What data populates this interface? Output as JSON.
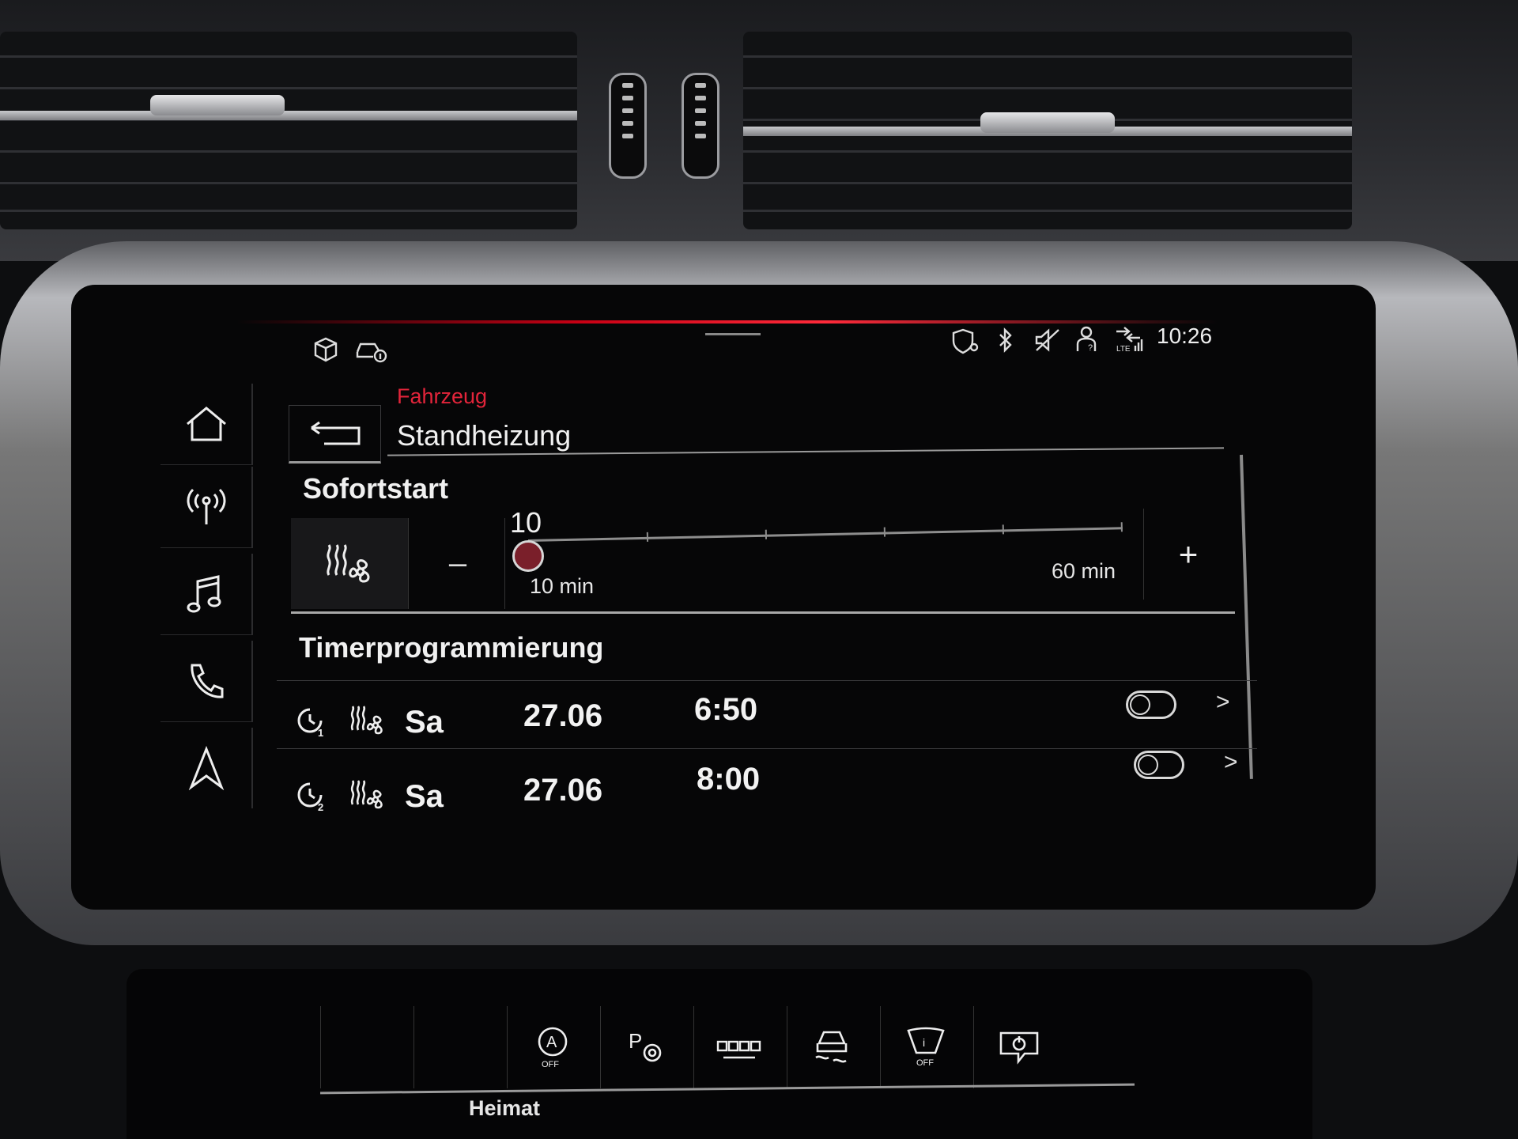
{
  "status_bar": {
    "clock": "10:26",
    "icons": [
      "package-icon",
      "car-info-icon",
      "location-shield-icon",
      "bluetooth-icon",
      "mute-icon",
      "driver-profile-icon",
      "lte-signal-icon"
    ]
  },
  "sidebar": {
    "items": [
      {
        "name": "home",
        "icon": "home-icon"
      },
      {
        "name": "radio",
        "icon": "antenna-icon"
      },
      {
        "name": "media",
        "icon": "music-note-icon"
      },
      {
        "name": "phone",
        "icon": "phone-icon"
      },
      {
        "name": "navigation",
        "icon": "navigation-arrow-icon"
      }
    ]
  },
  "header": {
    "breadcrumb": "Fahrzeug",
    "title": "Standheizung"
  },
  "sofortstart": {
    "title": "Sofortstart",
    "minus_label": "–",
    "plus_label": "+",
    "value": "10",
    "min_label": "10 min",
    "max_label": "60 min",
    "min": 10,
    "max": 60,
    "current": 10
  },
  "timer": {
    "title": "Timerprogrammierung",
    "rows": [
      {
        "timer_number": "1",
        "day": "Sa",
        "date": "27.06",
        "time": "6:50",
        "enabled": false
      },
      {
        "timer_number": "2",
        "day": "Sa",
        "date": "27.06",
        "time": "8:00",
        "enabled": false
      }
    ],
    "chevron": ">"
  },
  "console": {
    "label": "Heimat",
    "buttons": [
      "auto-hold-off-icon",
      "park-assist-icon",
      "surround-view-icon",
      "traction-off-icon",
      "lane-assist-off-icon",
      "power-icon"
    ],
    "off_label": "OFF"
  },
  "colors": {
    "accent_red": "#e2243a",
    "screen_bg": "#060607",
    "text": "#e9e9e9"
  }
}
